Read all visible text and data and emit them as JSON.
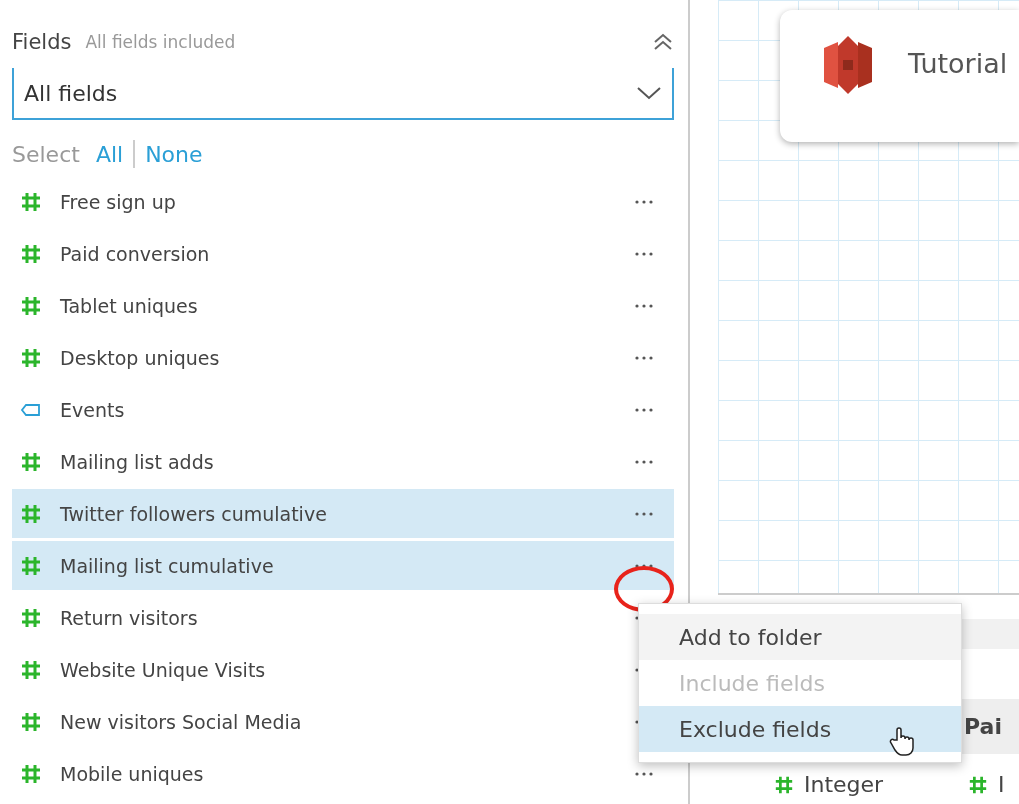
{
  "fields_panel": {
    "title": "Fields",
    "subtitle": "All fields included",
    "dropdown": {
      "value": "All fields"
    },
    "select": {
      "label": "Select",
      "all": "All",
      "none": "None"
    },
    "items": [
      {
        "name": "Free sign up",
        "kind": "measure",
        "selected": false
      },
      {
        "name": "Paid conversion",
        "kind": "measure",
        "selected": false
      },
      {
        "name": "Tablet uniques",
        "kind": "measure",
        "selected": false
      },
      {
        "name": "Desktop uniques",
        "kind": "measure",
        "selected": false
      },
      {
        "name": "Events",
        "kind": "dimension",
        "selected": false
      },
      {
        "name": "Mailing list adds",
        "kind": "measure",
        "selected": false
      },
      {
        "name": "Twitter followers cumulative",
        "kind": "measure",
        "selected": true
      },
      {
        "name": "Mailing list cumulative",
        "kind": "measure",
        "selected": true
      },
      {
        "name": "Return visitors",
        "kind": "measure",
        "selected": false
      },
      {
        "name": "Website Unique Visits",
        "kind": "measure",
        "selected": false
      },
      {
        "name": "New visitors Social Media",
        "kind": "measure",
        "selected": false
      },
      {
        "name": "Mobile uniques",
        "kind": "measure",
        "selected": false
      }
    ]
  },
  "context_menu": {
    "items": [
      {
        "label": "Add to folder",
        "disabled": false,
        "selected": false
      },
      {
        "label": "Include fields",
        "disabled": true,
        "selected": false
      },
      {
        "label": "Exclude fields",
        "disabled": false,
        "selected": true
      }
    ]
  },
  "canvas": {
    "card": {
      "title": "Tutorial"
    }
  },
  "preview_table": {
    "columns": [
      {
        "header": "Pai",
        "type": "I"
      }
    ],
    "first_column_type": "Integer"
  }
}
